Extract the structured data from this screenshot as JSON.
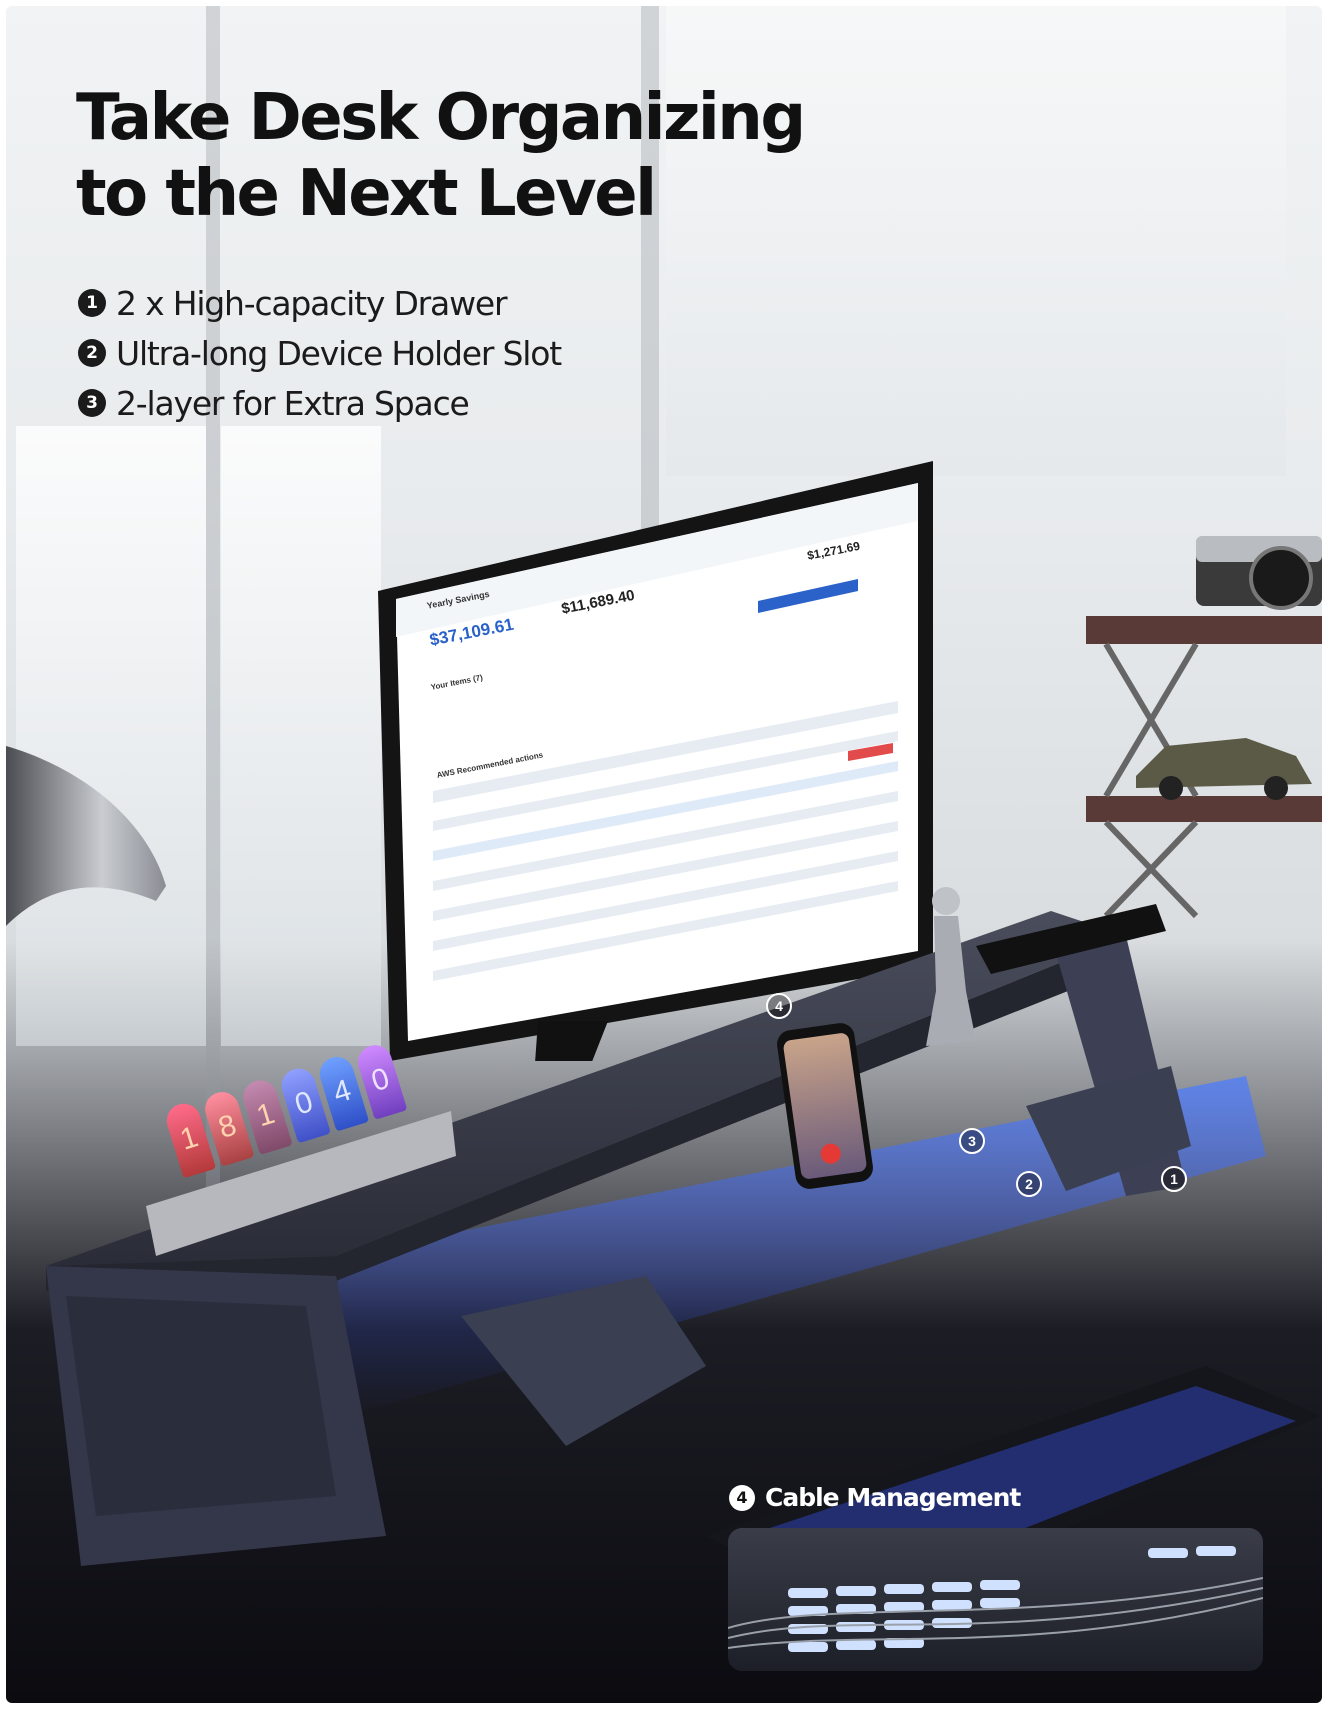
{
  "headline": {
    "line1": "Take Desk Organizing",
    "line2": "to the Next Level"
  },
  "features": [
    {
      "number": "1",
      "text": "2 x High-capacity Drawer"
    },
    {
      "number": "2",
      "text": "Ultra-long Device Holder Slot"
    },
    {
      "number": "3",
      "text": "2-layer for Extra Space"
    }
  ],
  "monitor_screen": {
    "title": "Yearly Savings",
    "value_main": "$37,109.61",
    "value_second": "$11,689.40",
    "value_third": "$1,271.69",
    "section_items": "Your Items (7)",
    "section_actions": "AWS Recommended actions"
  },
  "callouts": [
    "4",
    "3",
    "2",
    "1"
  ],
  "nixie_digits": [
    "1",
    "8",
    "1",
    "0",
    "4",
    "0"
  ],
  "cable": {
    "number": "4",
    "label": "Cable Management"
  },
  "colors": {
    "led_blue": "#2f6bff",
    "riser": "#2e3140",
    "accent_text": "#111111"
  }
}
